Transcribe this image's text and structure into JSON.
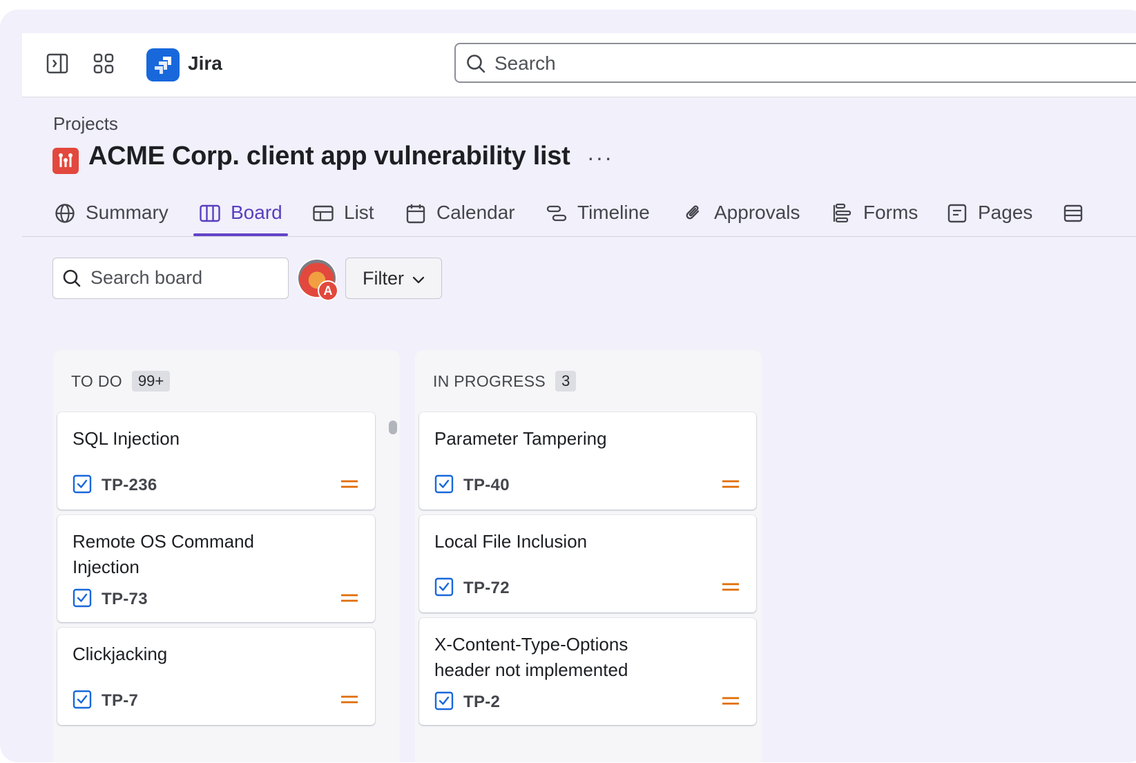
{
  "topnav": {
    "app_name": "Jira",
    "search_placeholder": "Search",
    "icons": [
      "sidebar-toggle-icon",
      "app-switcher-icon",
      "jira-logo-icon",
      "search-icon"
    ]
  },
  "header": {
    "breadcrumb": "Projects",
    "project_title": "ACME Corp. client app vulnerability list",
    "more_label": "···"
  },
  "tabs": [
    {
      "label": "Summary",
      "icon": "globe-icon",
      "active": false
    },
    {
      "label": "Board",
      "icon": "board-icon",
      "active": true
    },
    {
      "label": "List",
      "icon": "list-icon",
      "active": false
    },
    {
      "label": "Calendar",
      "icon": "calendar-icon",
      "active": false
    },
    {
      "label": "Timeline",
      "icon": "timeline-icon",
      "active": false
    },
    {
      "label": "Approvals",
      "icon": "paperclip-icon",
      "active": false
    },
    {
      "label": "Forms",
      "icon": "forms-icon",
      "active": false
    },
    {
      "label": "Pages",
      "icon": "pages-icon",
      "active": false
    }
  ],
  "toolbar": {
    "search_placeholder": "Search board",
    "avatar_badge": "A",
    "filter_label": "Filter"
  },
  "columns": [
    {
      "title": "TO DO",
      "count": "99+",
      "cards": [
        {
          "title": "SQL Injection",
          "key": "TP-236",
          "priority": "medium"
        },
        {
          "title": "Remote OS Command Injection",
          "key": "TP-73",
          "priority": "medium"
        },
        {
          "title": "Clickjacking",
          "key": "TP-7",
          "priority": "medium"
        }
      ]
    },
    {
      "title": "IN PROGRESS",
      "count": "3",
      "cards": [
        {
          "title": "Parameter Tampering",
          "key": "TP-40",
          "priority": "medium"
        },
        {
          "title": "Local File Inclusion",
          "key": "TP-72",
          "priority": "medium"
        },
        {
          "title": "X-Content-Type-Options header not implemented",
          "key": "TP-2",
          "priority": "medium"
        }
      ]
    }
  ],
  "colors": {
    "accent": "#6343c8",
    "jira_blue": "#1868db",
    "project_red": "#e2483d",
    "priority_orange": "#e06c00",
    "task_blue": "#1868db"
  }
}
